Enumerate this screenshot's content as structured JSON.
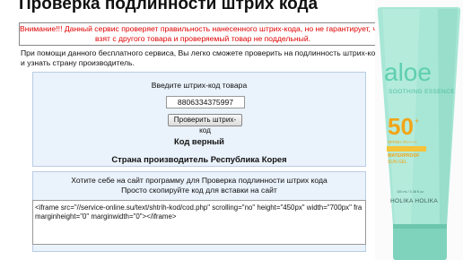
{
  "page": {
    "title": "Проверка подлинности штрих кода"
  },
  "warning": {
    "line1": "Внимание!!! Данный сервис проверяет правильность нанесенного штрих-кода, но не гарантирует, что п",
    "line2": "взят с другого товара и проверяемый товар не поддельный."
  },
  "intro": {
    "line1": "При помощи данного бесплатного сервиса, Вы легко сможете проверить на подлинность штрих-код на",
    "line2": "и узнать страну производитель."
  },
  "check_form": {
    "prompt": "Введите штрих-код товара",
    "barcode_value": "8806334375997",
    "button_label": "Проверить штрих-код"
  },
  "result": {
    "status": "Код верный",
    "country": "Страна производитель Республика Корея"
  },
  "embed": {
    "title_line1": "Хотите себе на сайт программу для Проверка подлинности штрих кода",
    "title_line2": "Просто скопируйте код для вставки на сайт",
    "code": "<iframe src=\"//service-online.su/text/shtrih-kod/cod.php\" scrolling=\"no\" height=\"450px\" width=\"700px\" fra\nmarginheight=\"0\" marginwidth=\"0\"></iframe>"
  },
  "product": {
    "brand": "aloe",
    "subtitle": "SOOTHING ESSENCE",
    "spf": "50",
    "spf_line1": "SPF50+ PA++++",
    "spf_line2": "WATERPROOF",
    "spf_line3": "SUN GEL",
    "volume": "100 ml / 3.38 fl.oz",
    "maker": "HOLIKA HOLIKA",
    "colors": {
      "tube": "#9be0cd",
      "cap": "#7fd3bc",
      "brand": "#5ecfb0",
      "spf_orange": "#f2a516"
    }
  }
}
